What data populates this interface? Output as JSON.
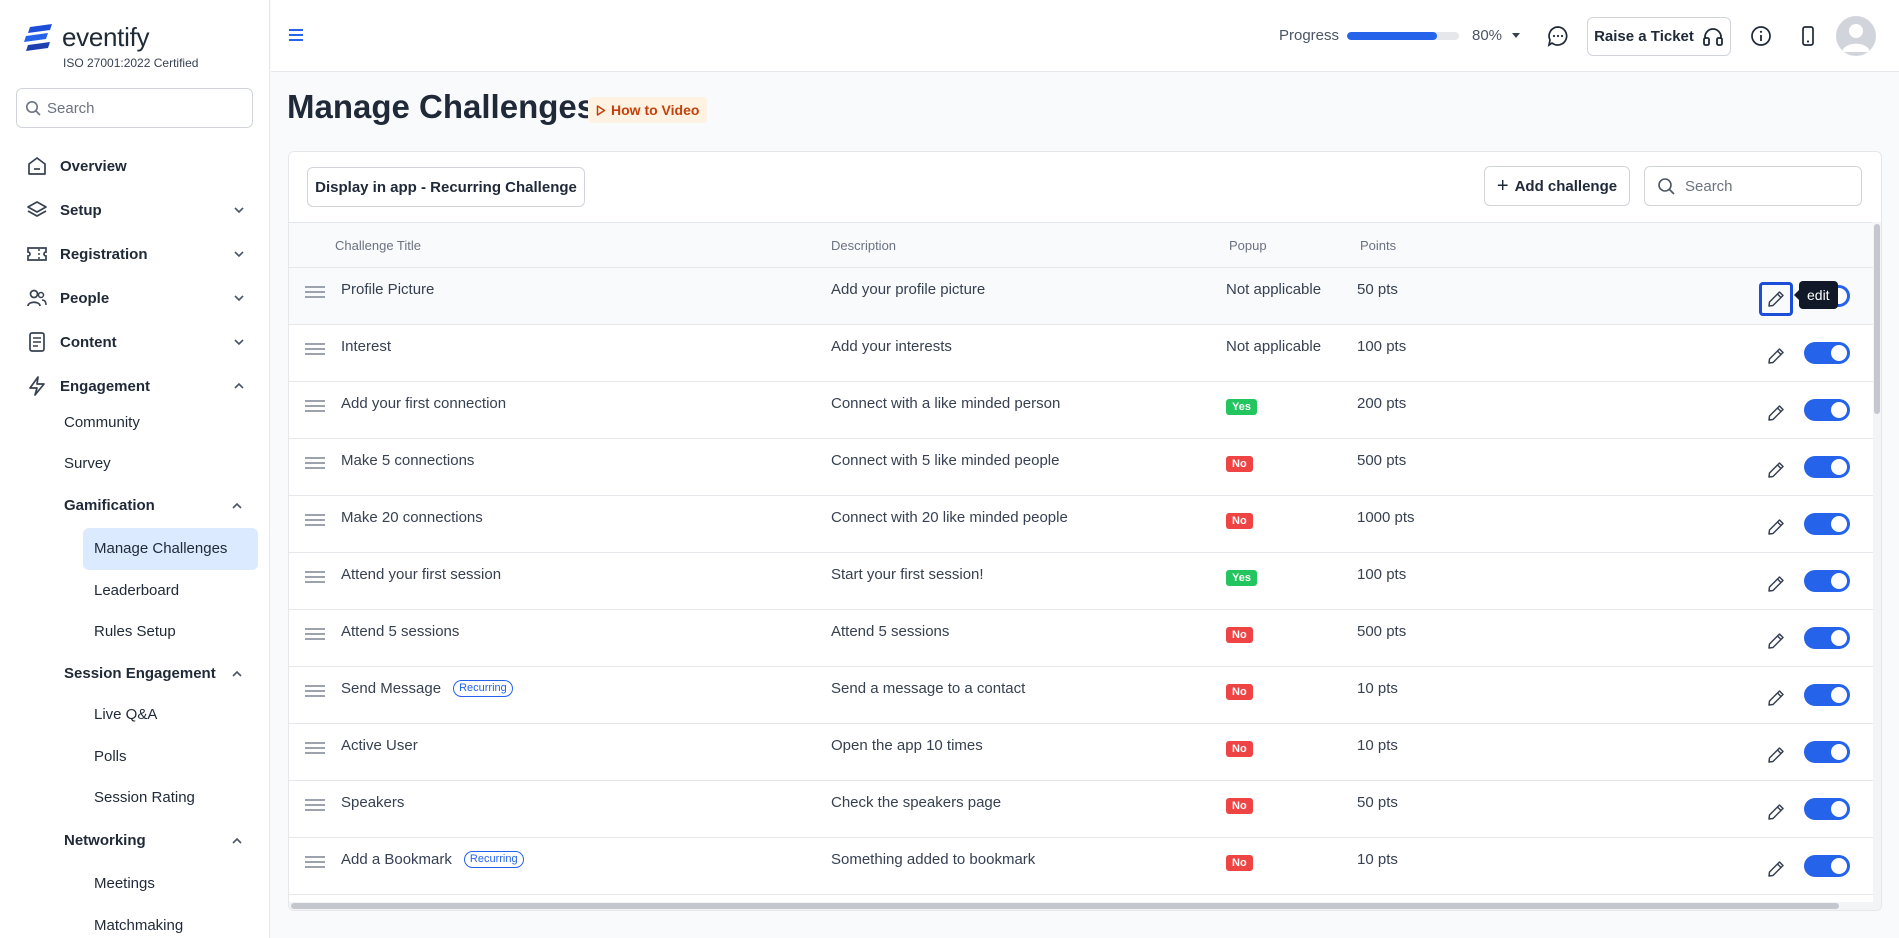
{
  "brand": {
    "name": "eventify",
    "certification": "ISO 27001:2022 Certified",
    "logo_icon": "eventify-logo-icon",
    "accent": "#2563eb"
  },
  "sidebar": {
    "search_placeholder": "Search",
    "top_items": [
      {
        "label": "Overview",
        "icon": "home-icon"
      },
      {
        "label": "Setup",
        "icon": "layers-icon"
      },
      {
        "label": "Registration",
        "icon": "ticket-icon"
      },
      {
        "label": "People",
        "icon": "users-icon"
      },
      {
        "label": "Content",
        "icon": "document-icon"
      },
      {
        "label": "Engagement",
        "icon": "bolt-icon"
      }
    ],
    "engagement_items": {
      "community": "Community",
      "survey": "Survey",
      "gamification": "Gamification",
      "manage_challenges": "Manage Challenges",
      "leaderboard": "Leaderboard",
      "rules_setup": "Rules Setup",
      "session_engagement": "Session Engagement",
      "live_qa": "Live Q&A",
      "polls": "Polls",
      "session_rating": "Session Rating",
      "networking": "Networking",
      "meetings": "Meetings",
      "matchmaking": "Matchmaking"
    }
  },
  "header": {
    "progress_label": "Progress",
    "progress_value": 0.8,
    "progress_text": "80%",
    "ticket_label": "Raise a Ticket"
  },
  "page": {
    "title": "Manage Challenges",
    "how_to_label": "How to Video",
    "display_button": "Display in app - Recurring Challenge",
    "add_button": "Add challenge",
    "search_placeholder": "Search"
  },
  "table": {
    "columns": [
      "Challenge Title",
      "Description",
      "Popup",
      "Points"
    ],
    "tooltip": "edit",
    "recurring_label": "Recurring",
    "rows": [
      {
        "title": "Profile Picture",
        "description": "Add your profile picture",
        "popup_text": "Not applicable",
        "points": "50 pts"
      },
      {
        "title": "Interest",
        "description": "Add your interests",
        "popup_text": "Not applicable",
        "points": "100 pts"
      },
      {
        "title": "Add your first connection",
        "description": "Connect with a like minded person",
        "popup_badge": "Yes",
        "points": "200 pts"
      },
      {
        "title": "Make 5 connections",
        "description": "Connect with 5 like minded people",
        "popup_badge": "No",
        "points": "500 pts"
      },
      {
        "title": "Make 20 connections",
        "description": "Connect with 20 like minded people",
        "popup_badge": "No",
        "points": "1000 pts"
      },
      {
        "title": "Attend your first session",
        "description": "Start your first session!",
        "popup_badge": "Yes",
        "points": "100 pts"
      },
      {
        "title": "Attend 5 sessions",
        "description": "Attend 5 sessions",
        "popup_badge": "No",
        "points": "500 pts"
      },
      {
        "title": "Send Message",
        "recurring": true,
        "description": "Send a message to a contact",
        "popup_badge": "No",
        "points": "10 pts"
      },
      {
        "title": "Active User",
        "description": "Open the app 10 times",
        "popup_badge": "No",
        "points": "10 pts"
      },
      {
        "title": "Speakers",
        "description": "Check the speakers page",
        "popup_badge": "No",
        "points": "50 pts"
      },
      {
        "title": "Add a Bookmark",
        "recurring": true,
        "description": "Something added to bookmark",
        "popup_badge": "No",
        "points": "10 pts"
      }
    ]
  }
}
